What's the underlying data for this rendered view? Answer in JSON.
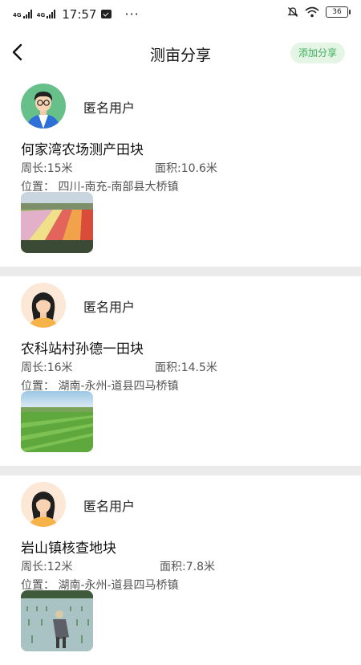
{
  "status_bar": {
    "network_1": "4G",
    "network_2": "4G",
    "time": "17:57",
    "more": "···",
    "battery": "36"
  },
  "header": {
    "title": "测亩分享",
    "add_share_label": "添加分享"
  },
  "posts": [
    {
      "user_name": "匿名用户",
      "avatar": "male-avatar",
      "field_name": "何家湾农场测产田块",
      "perimeter": "周长:15米",
      "area": "面积:10.6米",
      "location": "位置： 四川-南充-南部县大桥镇",
      "image": "flower-field-photo"
    },
    {
      "user_name": "匿名用户",
      "avatar": "female-avatar",
      "field_name": "农科站村孙德一田块",
      "perimeter": "周长:16米",
      "area": "面积:14.5米",
      "location": "位置： 湖南-永州-道县四马桥镇",
      "image": "green-field-photo"
    },
    {
      "user_name": "匿名用户",
      "avatar": "female-avatar",
      "field_name": "岩山镇核查地块",
      "perimeter": "周长:12米",
      "area": "面积:7.8米",
      "location": "位置： 湖南-永州-道县四马桥镇",
      "image": "rice-planting-photo"
    }
  ],
  "colors": {
    "accent_green": "#3fae5a",
    "accent_green_bg": "#e4f5e6",
    "divider": "#ebebeb"
  }
}
